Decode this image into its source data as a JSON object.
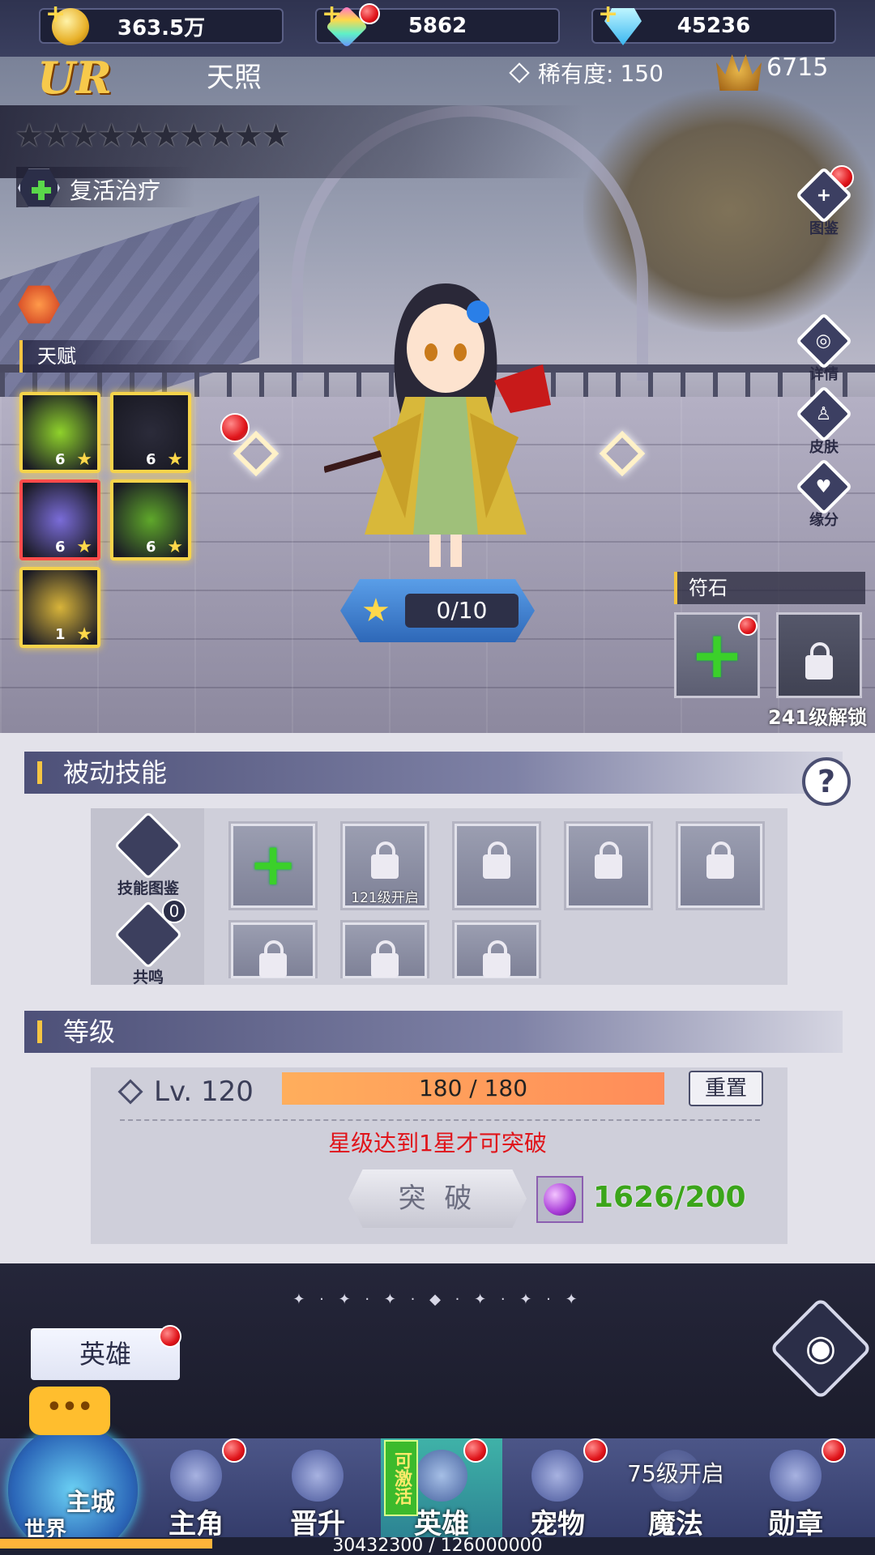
{
  "resources": {
    "gold": "363.5万",
    "rainbow_gem": "5862",
    "diamond": "45236"
  },
  "hero": {
    "rank": "UR",
    "name": "天照",
    "rarity_label": "稀有度:",
    "rarity_value": "150",
    "power": "6715",
    "stars_filled": 0,
    "stars_total": 10,
    "role_skill": "复活治疗",
    "talent_header": "天赋",
    "talents": [
      {
        "level": "6",
        "color": "#8fd22b"
      },
      {
        "level": "6",
        "color": "#2b2b3a"
      },
      {
        "level": "6",
        "color": "#7a6cd8"
      },
      {
        "level": "6",
        "color": "#5fa82a"
      },
      {
        "level": "1",
        "color": "#d8b43a"
      }
    ],
    "star_up_progress": "0/10"
  },
  "side_buttons": [
    "图鉴",
    "详情",
    "皮肤",
    "缘分"
  ],
  "runes": {
    "header": "符石",
    "unlock_text": "241级解锁"
  },
  "passive": {
    "header": "被动技能",
    "help": "?",
    "codex_label": "技能图鉴",
    "resonance_label": "共鸣",
    "resonance_count": "0",
    "slot_unlock_text": "121级开启"
  },
  "level": {
    "header": "等级",
    "lv_text": "Lv. 120",
    "exp": "180 / 180",
    "reset": "重置",
    "warning": "星级达到1星才可突破",
    "break_label": "突 破",
    "cost": "1626/200"
  },
  "bottom": {
    "decor": "✦ · ✦ · ✦ · ◆ · ✦ · ✦ · ✦",
    "hero_tab": "英雄",
    "chat": "•••",
    "world_city": "主城",
    "world_label": "世界",
    "nav": [
      "主角",
      "晋升",
      "英雄",
      "宠物",
      "魔法",
      "勋章"
    ],
    "activate_badge": "可激活",
    "magic_unlock": "75级开启",
    "account_exp": "30432300 / 126000000"
  },
  "colors": {
    "accent_gold": "#f5c542",
    "warning_red": "#e0141a",
    "cost_green": "#3ba51a"
  }
}
